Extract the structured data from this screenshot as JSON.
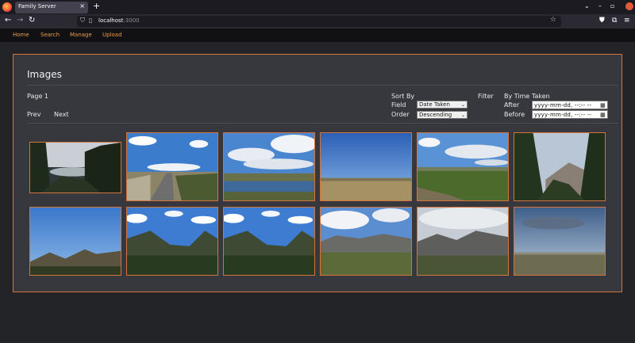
{
  "browser": {
    "tab_title": "Family Server",
    "tab_close": "×",
    "new_tab": "+",
    "url_host": "localhost",
    "url_port": ":3000"
  },
  "site_nav": {
    "items": [
      {
        "label": "Home"
      },
      {
        "label": "Search"
      },
      {
        "label": "Manage"
      },
      {
        "label": "Upload"
      }
    ]
  },
  "page": {
    "title": "Images",
    "page_label": "Page 1",
    "prev": "Prev",
    "next": "Next"
  },
  "sort": {
    "heading": "Sort By",
    "field_label": "Field",
    "field_value": "Date Taken",
    "order_label": "Order",
    "order_value": "Descending"
  },
  "filter": {
    "heading": "Filter",
    "subheading": "By Time Taken",
    "after_label": "After",
    "before_label": "Before",
    "after_placeholder": "yyyy-mm-dd, --:-- --",
    "before_placeholder": "yyyy-mm-dd, --:-- --"
  },
  "gallery": {
    "images": [
      {
        "scene": "forest-lake"
      },
      {
        "scene": "railroad-blue-sky"
      },
      {
        "scene": "marsh-clouds"
      },
      {
        "scene": "grassland-horizon"
      },
      {
        "scene": "prairie-clouds"
      },
      {
        "scene": "pine-mountain"
      },
      {
        "scene": "mountain-blue-sky"
      },
      {
        "scene": "valley-clouds"
      },
      {
        "scene": "valley-clouds-2"
      },
      {
        "scene": "alpine-tundra"
      },
      {
        "scene": "alpine-ridge"
      },
      {
        "scene": "stormy-plain"
      }
    ]
  },
  "colors": {
    "accent": "#d4743a",
    "link": "#f09a45",
    "panel_bg": "#37383d",
    "page_bg": "#232428"
  }
}
